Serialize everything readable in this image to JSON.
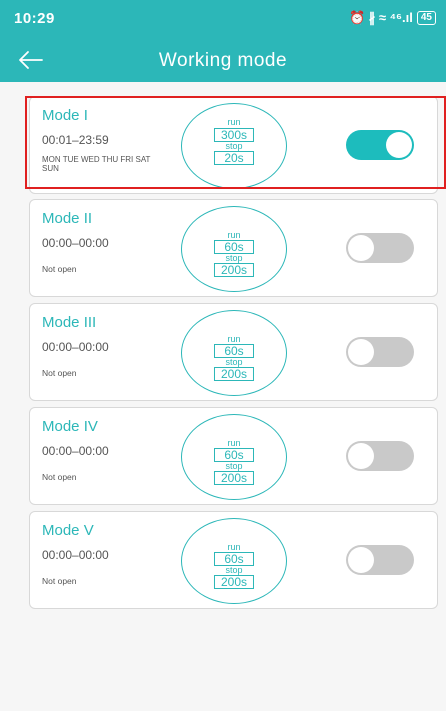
{
  "status_bar": {
    "time": "10:29",
    "icons_text": "⏰ ∦ ≈ ⁴⁶.ıl",
    "battery": "45"
  },
  "header": {
    "title": "Working mode",
    "back_icon": "back-arrow-icon"
  },
  "colors": {
    "accent": "#2cb7b8",
    "highlight": "#e02020",
    "toggle_off": "#c9c9c9"
  },
  "modes": [
    {
      "name": "Mode I",
      "time": "00:01–23:59",
      "days": "MON TUE WED THU FRI SAT SUN",
      "status": "",
      "run_label": "run",
      "run": "300s",
      "stop_label": "stop",
      "stop": "20s",
      "enabled": true
    },
    {
      "name": "Mode II",
      "time": "00:00–00:00",
      "days": "",
      "status": "Not open",
      "run_label": "run",
      "run": "60s",
      "stop_label": "stop",
      "stop": "200s",
      "enabled": false
    },
    {
      "name": "Mode III",
      "time": "00:00–00:00",
      "days": "",
      "status": "Not open",
      "run_label": "run",
      "run": "60s",
      "stop_label": "stop",
      "stop": "200s",
      "enabled": false
    },
    {
      "name": "Mode IV",
      "time": "00:00–00:00",
      "days": "",
      "status": "Not open",
      "run_label": "run",
      "run": "60s",
      "stop_label": "stop",
      "stop": "200s",
      "enabled": false
    },
    {
      "name": "Mode V",
      "time": "00:00–00:00",
      "days": "",
      "status": "Not open",
      "run_label": "run",
      "run": "60s",
      "stop_label": "stop",
      "stop": "200s",
      "enabled": false
    }
  ]
}
